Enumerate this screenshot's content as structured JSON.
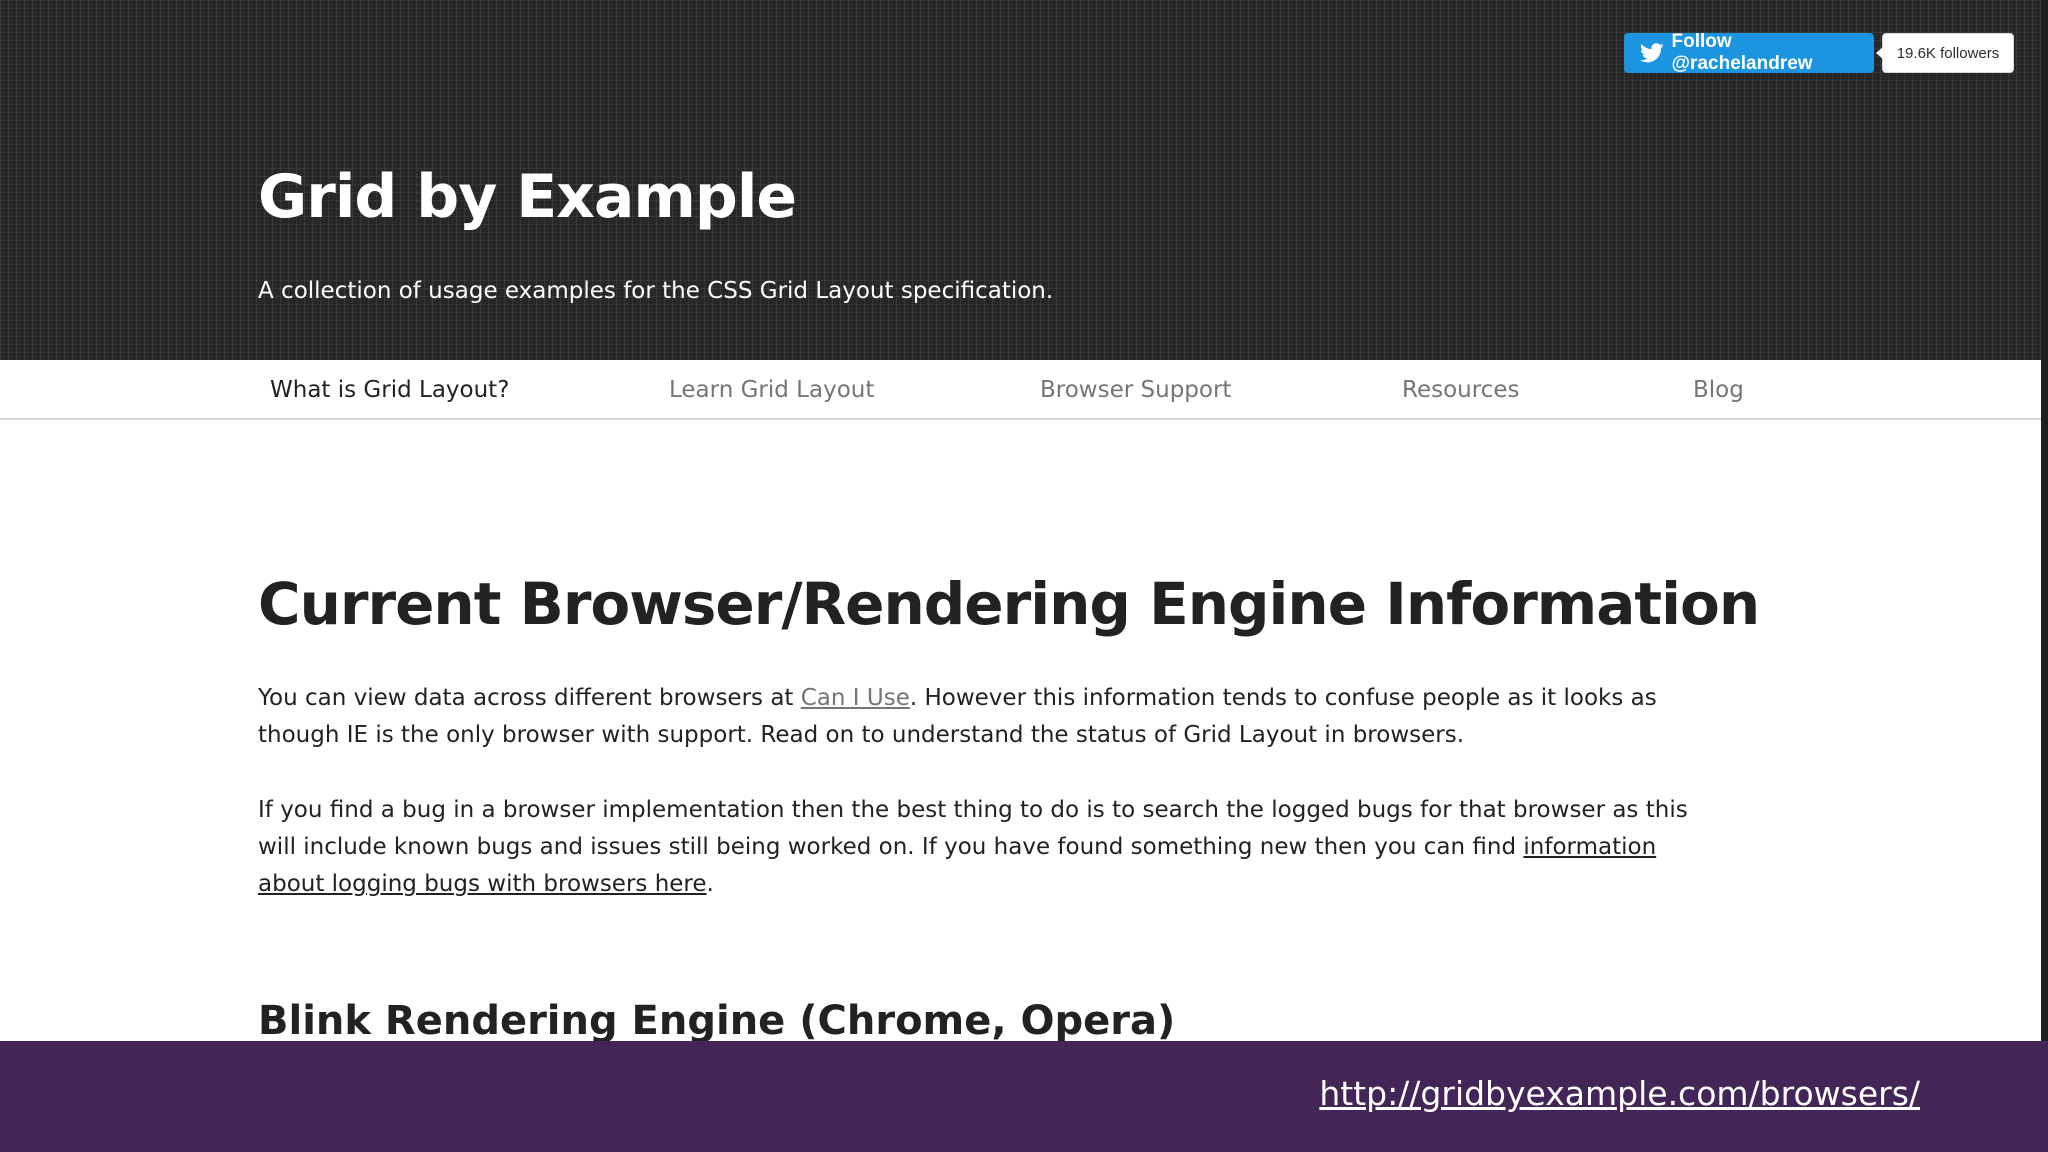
{
  "header": {
    "title": "Grid by Example",
    "tagline": "A collection of usage examples for the CSS Grid Layout specification.",
    "twitter_follow": "Follow @rachelandrew",
    "followers": "19.6K followers"
  },
  "nav": {
    "items": [
      {
        "label": "What is Grid Layout?",
        "active": true
      },
      {
        "label": "Learn Grid Layout"
      },
      {
        "label": "Browser Support"
      },
      {
        "label": "Resources"
      },
      {
        "label": "Blog"
      }
    ]
  },
  "main": {
    "heading": "Current Browser/Rendering Engine Information",
    "para1": {
      "before": "You can view data across different browsers at ",
      "link": "Can I Use",
      "after": ". However this information tends to confuse people as it looks as though IE is the only browser with support. Read on to understand the status of Grid Layout in browsers."
    },
    "para2": {
      "before": "If you find a bug in a browser implementation then the best thing to do is to search the logged bugs for that browser as this will include known bugs and issues still being worked on. If you have found something new then you can find ",
      "link": "information about logging bugs with browsers here",
      "after": "."
    },
    "subheading": "Blink Rendering Engine (Chrome, Opera)"
  },
  "footer": {
    "url": "http://gridbyexample.com/browsers/"
  },
  "colors": {
    "header_bg": "#272727",
    "twitter_blue": "#1b95e0",
    "slide_bar": "#432657"
  },
  "icons": {
    "twitter": "twitter-bird-icon"
  }
}
